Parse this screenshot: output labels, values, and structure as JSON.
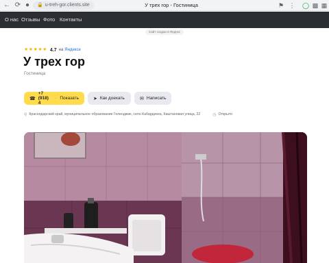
{
  "browser": {
    "url": "u-treh-gor.clients.site",
    "tab_title": "У трех гор - Гостиница"
  },
  "nav": {
    "items": [
      "О нас",
      "Отзывы",
      "Фото",
      "Контакты"
    ]
  },
  "made_by": "Сайт создан в Яндекс",
  "header": {
    "rating_value": "4.7",
    "rating_on": "на",
    "rating_source": "Яндексе",
    "stars": 5,
    "title": "У трех гор",
    "category": "Гостиница"
  },
  "actions": {
    "phone": "+7 (918) 4",
    "phone_fade": "··",
    "show_label": "Показать",
    "route_label": "Как доехать",
    "write_label": "Написать"
  },
  "address": {
    "text": "Краснодарский край, муниципальное образование Геленджик, село Кабардинка, Каштановая улица, 22",
    "status": "Открыто"
  },
  "colors": {
    "accent": "#ffdb4d",
    "nav_bg": "#2b2f33",
    "star": "#f6b600"
  }
}
